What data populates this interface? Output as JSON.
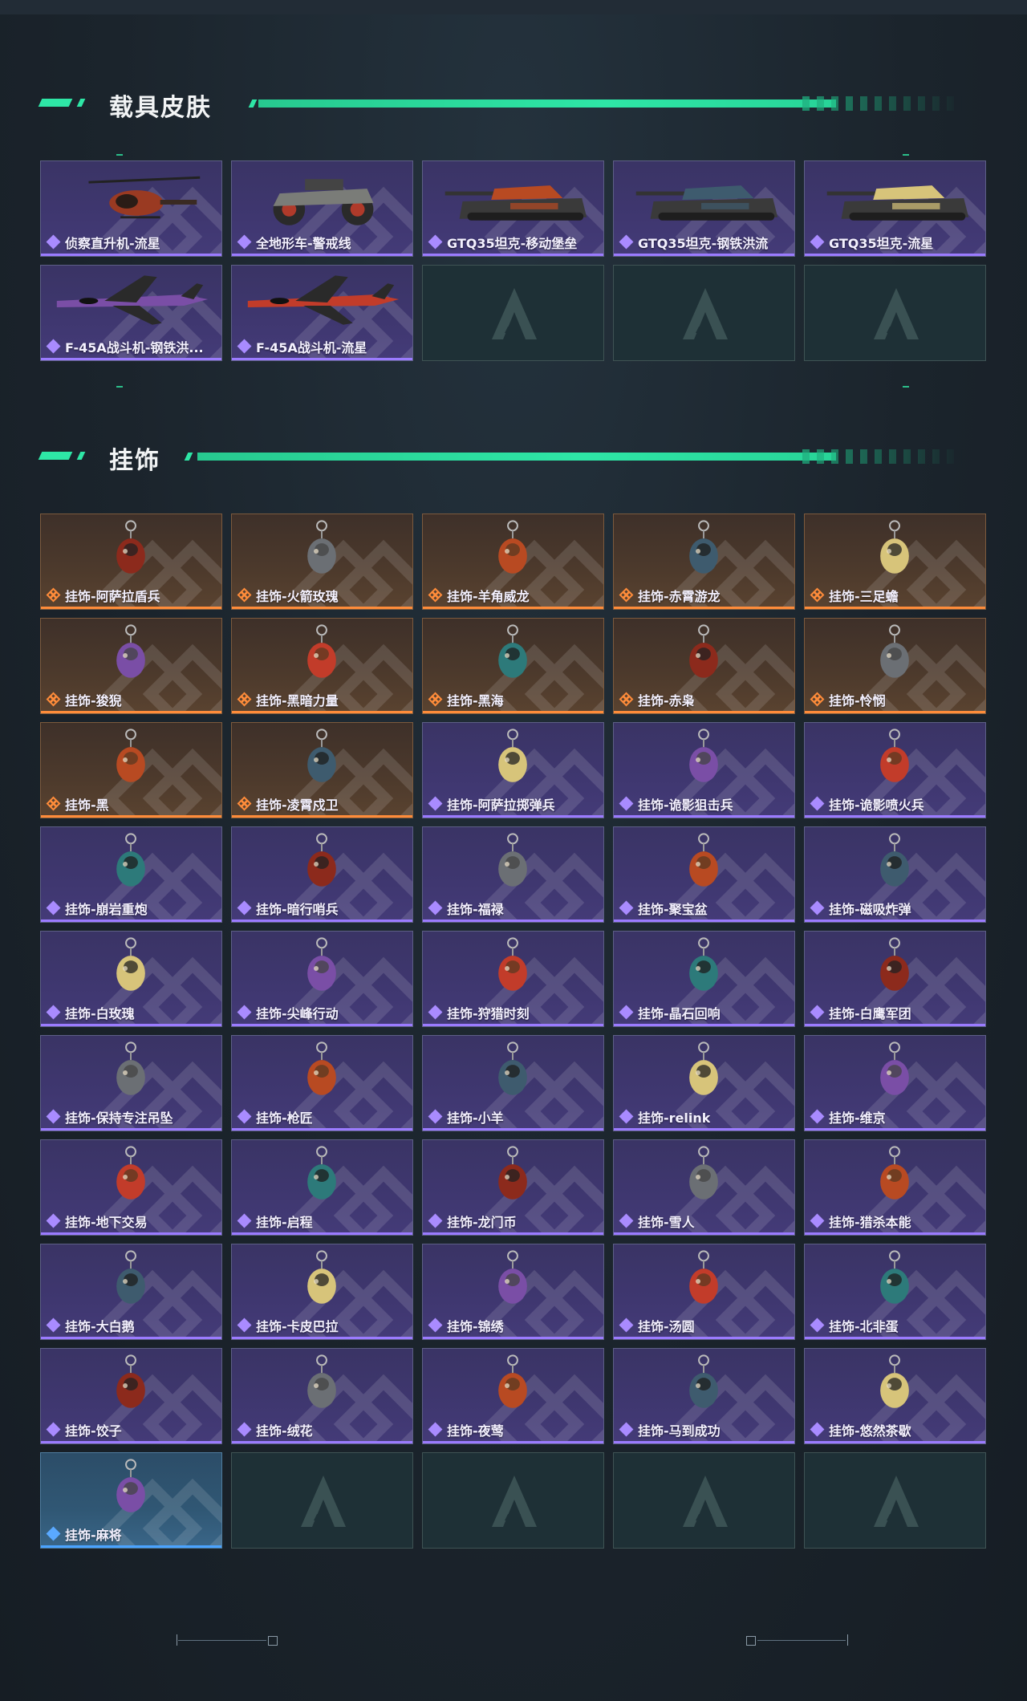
{
  "sections": {
    "vehicle": {
      "title": "载具皮肤"
    },
    "charm": {
      "title": "挂饰"
    }
  },
  "vehicle_items": [
    {
      "label": "侦察直升机-流星",
      "rarity": "purple",
      "icon": "helicopter-icon"
    },
    {
      "label": "全地形车-警戒线",
      "rarity": "purple",
      "icon": "atv-icon"
    },
    {
      "label": "GTQ35坦克-移动堡垒",
      "rarity": "purple",
      "icon": "tank-icon"
    },
    {
      "label": "GTQ35坦克-钢铁洪流",
      "rarity": "purple",
      "icon": "tank-icon"
    },
    {
      "label": "GTQ35坦克-流星",
      "rarity": "purple",
      "icon": "tank-icon"
    },
    {
      "label": "F-45A战斗机-钢铁洪...",
      "rarity": "purple",
      "icon": "jet-icon"
    },
    {
      "label": "F-45A战斗机-流星",
      "rarity": "purple",
      "icon": "jet-icon"
    }
  ],
  "charm_items": [
    {
      "label": "挂饰-阿萨拉盾兵",
      "rarity": "orange"
    },
    {
      "label": "挂饰-火箭玫瑰",
      "rarity": "orange"
    },
    {
      "label": "挂饰-羊角威龙",
      "rarity": "orange"
    },
    {
      "label": "挂饰-赤霄游龙",
      "rarity": "orange"
    },
    {
      "label": "挂饰-三足蟾",
      "rarity": "orange"
    },
    {
      "label": "挂饰-狻猊",
      "rarity": "orange"
    },
    {
      "label": "挂饰-黑暗力量",
      "rarity": "orange"
    },
    {
      "label": "挂饰-黑海",
      "rarity": "orange"
    },
    {
      "label": "挂饰-赤枭",
      "rarity": "orange"
    },
    {
      "label": "挂饰-怜悯",
      "rarity": "orange"
    },
    {
      "label": "挂饰-黑",
      "rarity": "orange"
    },
    {
      "label": "挂饰-凌霄戍卫",
      "rarity": "orange"
    },
    {
      "label": "挂饰-阿萨拉掷弹兵",
      "rarity": "purple"
    },
    {
      "label": "挂饰-诡影狙击兵",
      "rarity": "purple"
    },
    {
      "label": "挂饰-诡影喷火兵",
      "rarity": "purple"
    },
    {
      "label": "挂饰-崩岩重炮",
      "rarity": "purple"
    },
    {
      "label": "挂饰-暗行哨兵",
      "rarity": "purple"
    },
    {
      "label": "挂饰-福禄",
      "rarity": "purple"
    },
    {
      "label": "挂饰-聚宝盆",
      "rarity": "purple"
    },
    {
      "label": "挂饰-磁吸炸弹",
      "rarity": "purple"
    },
    {
      "label": "挂饰-白玫瑰",
      "rarity": "purple"
    },
    {
      "label": "挂饰-尖峰行动",
      "rarity": "purple"
    },
    {
      "label": "挂饰-狩猎时刻",
      "rarity": "purple"
    },
    {
      "label": "挂饰-晶石回响",
      "rarity": "purple"
    },
    {
      "label": "挂饰-白鹰军团",
      "rarity": "purple"
    },
    {
      "label": "挂饰-保持专注吊坠",
      "rarity": "purple"
    },
    {
      "label": "挂饰-枪匠",
      "rarity": "purple"
    },
    {
      "label": "挂饰-小羊",
      "rarity": "purple"
    },
    {
      "label": "挂饰-relink",
      "rarity": "purple"
    },
    {
      "label": "挂饰-维京",
      "rarity": "purple"
    },
    {
      "label": "挂饰-地下交易",
      "rarity": "purple"
    },
    {
      "label": "挂饰-启程",
      "rarity": "purple"
    },
    {
      "label": "挂饰-龙门币",
      "rarity": "purple"
    },
    {
      "label": "挂饰-雪人",
      "rarity": "purple"
    },
    {
      "label": "挂饰-猎杀本能",
      "rarity": "purple"
    },
    {
      "label": "挂饰-大白鹅",
      "rarity": "purple"
    },
    {
      "label": "挂饰-卡皮巴拉",
      "rarity": "purple"
    },
    {
      "label": "挂饰-锦绣",
      "rarity": "purple"
    },
    {
      "label": "挂饰-汤圆",
      "rarity": "purple"
    },
    {
      "label": "挂饰-北非蛋",
      "rarity": "purple"
    },
    {
      "label": "挂饰-饺子",
      "rarity": "purple"
    },
    {
      "label": "挂饰-绒花",
      "rarity": "purple"
    },
    {
      "label": "挂饰-夜莺",
      "rarity": "purple"
    },
    {
      "label": "挂饰-马到成功",
      "rarity": "purple"
    },
    {
      "label": "挂饰-悠然茶歇",
      "rarity": "purple"
    },
    {
      "label": "挂饰-麻将",
      "rarity": "blue"
    }
  ],
  "colors": {
    "accent": "#2ee6a6",
    "purple_rarity": "#9b7bff",
    "orange_rarity": "#ff8c3a",
    "blue_rarity": "#4aa3ff"
  }
}
